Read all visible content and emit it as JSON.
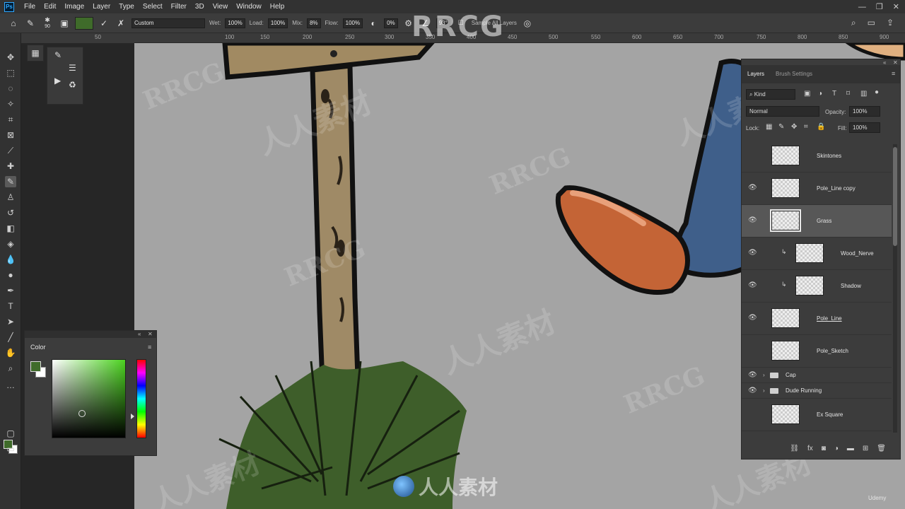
{
  "menu": [
    "File",
    "Edit",
    "Image",
    "Layer",
    "Type",
    "Select",
    "Filter",
    "3D",
    "View",
    "Window",
    "Help"
  ],
  "options": {
    "brush_size": "90",
    "preset": "Custom",
    "wet_label": "Wet:",
    "wet_value": "100%",
    "load_label": "Load:",
    "load_value": "100%",
    "mix_label": "Mix:",
    "mix_value": "8%",
    "flow_label": "Flow:",
    "flow_value": "100%",
    "smoothing_value": "0%",
    "angle_value": "93°",
    "sample_all_layers": "Sample All Layers",
    "fg_color": "#3f6b2a"
  },
  "ruler_ticks": [
    "50",
    "100",
    "150",
    "200",
    "250",
    "300",
    "350",
    "400",
    "450",
    "500",
    "550",
    "600",
    "650",
    "700",
    "750",
    "800",
    "850",
    "900"
  ],
  "color_panel": {
    "title": "Color",
    "hue_color": "#4cd320"
  },
  "layers_panel": {
    "tabs": [
      "Layers",
      "Brush Settings"
    ],
    "filter_kind": "Kind",
    "blend_mode": "Normal",
    "opacity_label": "Opacity:",
    "opacity_value": "100%",
    "lock_label": "Lock:",
    "fill_label": "Fill:",
    "fill_value": "100%",
    "layers": [
      {
        "name": "Skintones",
        "visible": false
      },
      {
        "name": "Pole_Line copy",
        "visible": true
      },
      {
        "name": "Grass",
        "visible": true,
        "selected": true
      },
      {
        "name": "Wood_Nerve",
        "visible": true,
        "clipped": true
      },
      {
        "name": "Shadow",
        "visible": true,
        "clipped": true
      },
      {
        "name": "Pole_Line",
        "visible": true
      },
      {
        "name": "Pole_Sketch",
        "visible": false
      },
      {
        "name": "Cap",
        "visible": true,
        "folder": true
      },
      {
        "name": "Dude Running",
        "visible": true,
        "folder": true
      },
      {
        "name": "Ex Square",
        "visible": false
      }
    ]
  },
  "watermarks": {
    "top": "RRCG",
    "bottom": "人人素材",
    "tile_a": "RRCG",
    "tile_b": "人人素材"
  },
  "udemy": "Udemy"
}
